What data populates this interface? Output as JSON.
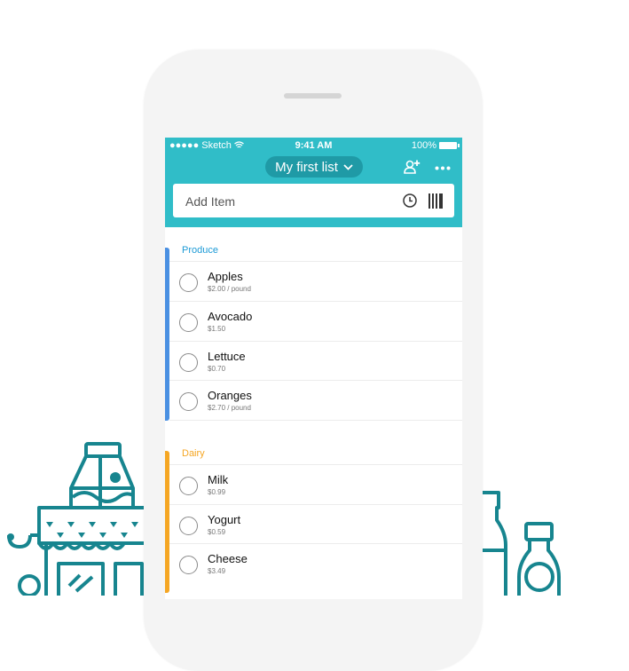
{
  "status_bar": {
    "carrier": "●●●●● Sketch",
    "time": "9:41 AM",
    "battery": "100%"
  },
  "header": {
    "list_title": "My first list",
    "add_placeholder": "Add Item"
  },
  "icons": {
    "dropdown": "chevron-down-icon",
    "share": "add-person-icon",
    "more": "more-icon",
    "history": "clock-icon",
    "scan": "barcode-icon"
  },
  "colors": {
    "accent": "#30bdc8",
    "pill": "#1f9aa6",
    "produce": "#4a90e2",
    "dairy": "#f5a623",
    "illustration": "#17858f"
  },
  "sections": [
    {
      "title": "Produce",
      "items": [
        {
          "name": "Apples",
          "price": "$2.00 / pound"
        },
        {
          "name": "Avocado",
          "price": "$1.50"
        },
        {
          "name": "Lettuce",
          "price": "$0.70"
        },
        {
          "name": "Oranges",
          "price": "$2.70 / pound"
        }
      ]
    },
    {
      "title": "Dairy",
      "items": [
        {
          "name": "Milk",
          "price": "$0.99"
        },
        {
          "name": "Yogurt",
          "price": "$0.59"
        },
        {
          "name": "Cheese",
          "price": "$3.49"
        }
      ]
    }
  ]
}
